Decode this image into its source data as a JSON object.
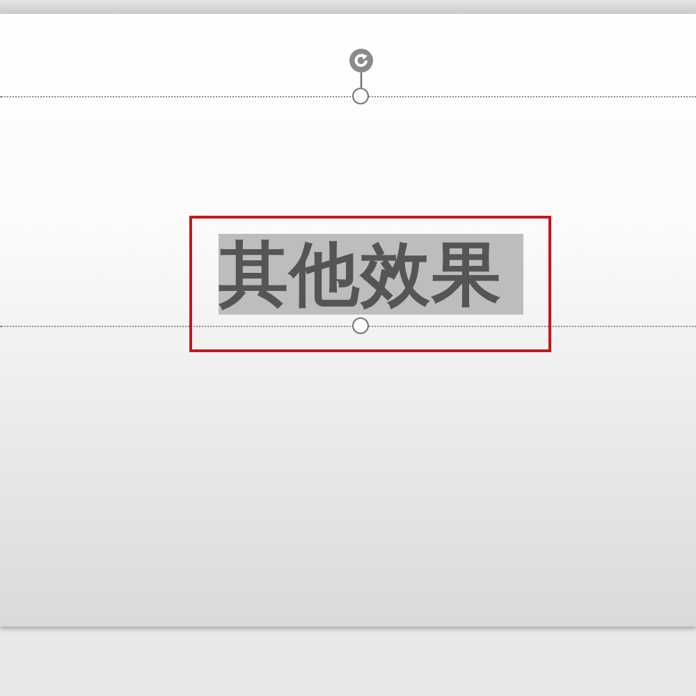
{
  "slide": {
    "title_box": {
      "text": "其他效果",
      "text_selected": true
    }
  }
}
